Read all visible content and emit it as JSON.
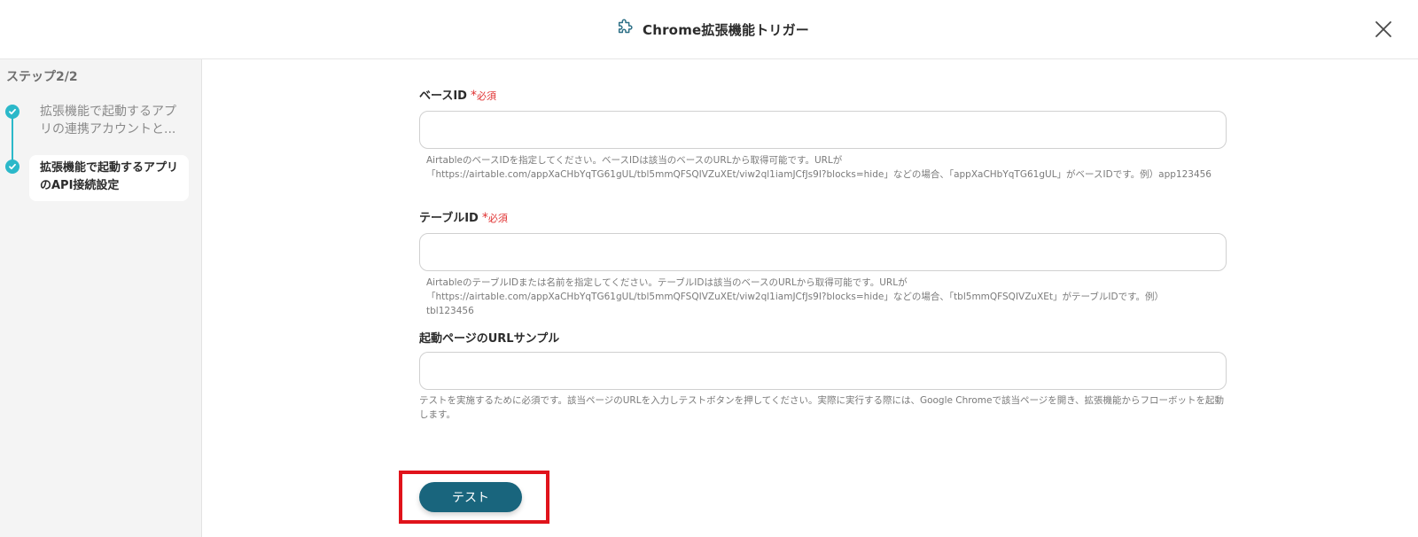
{
  "header": {
    "title": "Chrome拡張機能トリガー",
    "icon": "puzzle-icon",
    "close_icon": "close-icon"
  },
  "sidebar": {
    "step_heading": "ステップ2/2",
    "steps": [
      {
        "label": "拡張機能で起動するアプリの連携アカウントと...",
        "state": "done"
      },
      {
        "label": "拡張機能で起動するアプリのAPI接続設定",
        "state": "active"
      }
    ]
  },
  "form": {
    "required_label": "必須",
    "required_mark": "*",
    "fields": [
      {
        "label": "ベースID",
        "required": true,
        "value": "",
        "help": "AirtableのベースIDを指定してください。ベースIDは該当のベースのURLから取得可能です。URLが「https://airtable.com/appXaCHbYqTG61gUL/tbl5mmQFSQIVZuXEt/viw2ql1iamJCfJs9I?blocks=hide」などの場合、「appXaCHbYqTG61gUL」がベースIDです。例）app123456"
      },
      {
        "label": "テーブルID",
        "required": true,
        "value": "",
        "help": "AirtableのテーブルIDまたは名前を指定してください。テーブルIDは該当のベースのURLから取得可能です。URLが「https://airtable.com/appXaCHbYqTG61gUL/tbl5mmQFSQIVZuXEt/viw2ql1iamJCfJs9I?blocks=hide」などの場合、「tbl5mmQFSQIVZuXEt」がテーブルIDです。例）tbl123456"
      },
      {
        "label": "起動ページのURLサンプル",
        "required": false,
        "value": "",
        "help": "テストを実施するために必須です。該当ページのURLを入力しテストボタンを押してください。実際に実行する際には、Google Chromeで該当ページを開き、拡張機能からフローボットを起動します。"
      }
    ]
  },
  "actions": {
    "test_label": "テスト"
  },
  "colors": {
    "accent": "#2bb8c9",
    "primary_button": "#19657d",
    "required": "#e03131",
    "highlight_border": "#e0131b"
  }
}
